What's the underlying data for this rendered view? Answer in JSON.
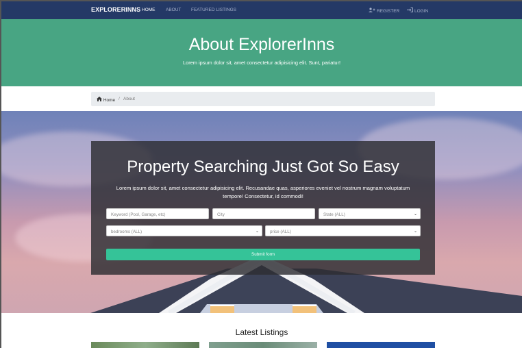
{
  "navbar": {
    "brand": "EXPLORERINNS",
    "links": [
      "HOME",
      "ABOUT",
      "FEATURED LISTINGS"
    ],
    "register": "REGISTER",
    "login": "LOGIN"
  },
  "showcase": {
    "title": "About ExplorerInns",
    "subtitle": "Lorem ipsum dolor sit, amet consectetur adipisicing elit. Sunt, pariatur!"
  },
  "breadcrumb": {
    "home": "Home",
    "separator": "/",
    "current": "About"
  },
  "search": {
    "title": "Property Searching Just Got So Easy",
    "lead": "Lorem ipsum dolor sit, amet consectetur adipisicing elit. Recusandae quas, asperiores eveniet vel nostrum magnam voluptatum tempore! Consectetur, id commodi!",
    "keyword_placeholder": "Keyword (Pool, Garage, etc)",
    "city_placeholder": "City",
    "state_selected": "State (ALL)",
    "bedrooms_selected": "bedrooms (ALL)",
    "price_selected": "price (ALL)",
    "submit_label": "Submit form"
  },
  "latest": {
    "title": "Latest Listings"
  },
  "colors": {
    "navbar": "#243966",
    "showcase": "#48a583",
    "submit": "#35c398",
    "card_blue": "#1f4fa3"
  },
  "icons": {
    "register": "user-plus-icon",
    "login": "sign-in-icon",
    "home": "home-icon",
    "select": "chevron-down-icon"
  }
}
